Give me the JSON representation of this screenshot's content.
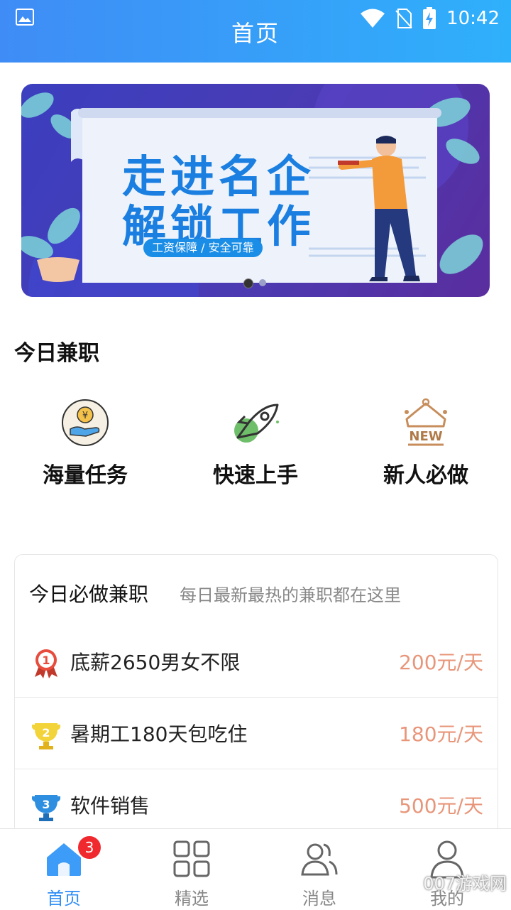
{
  "status_bar": {
    "time": "10:42"
  },
  "header": {
    "title": "首页"
  },
  "banner": {
    "line1": "走进名企",
    "line2": "解锁工作",
    "tag": "工资保障 / 安全可靠",
    "dots": 2,
    "active_dot": 1
  },
  "today": {
    "title": "今日兼职",
    "items": [
      {
        "label": "海量任务",
        "icon": "coin-hand-icon"
      },
      {
        "label": "快速上手",
        "icon": "rocket-icon"
      },
      {
        "label": "新人必做",
        "icon": "new-crown-icon"
      }
    ]
  },
  "must_do": {
    "title": "今日必做兼职",
    "subtitle": "每日最新最热的兼职都在这里",
    "rows": [
      {
        "rank": "1",
        "name": "底薪2650男女不限",
        "pay": "200元/天"
      },
      {
        "rank": "2",
        "name": "暑期工180天包吃住",
        "pay": "180元/天"
      },
      {
        "rank": "3",
        "name": "软件销售",
        "pay": "500元/天"
      }
    ]
  },
  "tabs": [
    {
      "label": "首页",
      "icon": "home-icon",
      "badge": "3"
    },
    {
      "label": "精选",
      "icon": "grid-icon"
    },
    {
      "label": "消息",
      "icon": "users-icon"
    },
    {
      "label": "我的",
      "icon": "user-icon"
    }
  ],
  "watermark": "007游戏网",
  "colors": {
    "accent": "#2f8ef5",
    "pay": "#e8967a",
    "badge": "#f0292f"
  }
}
